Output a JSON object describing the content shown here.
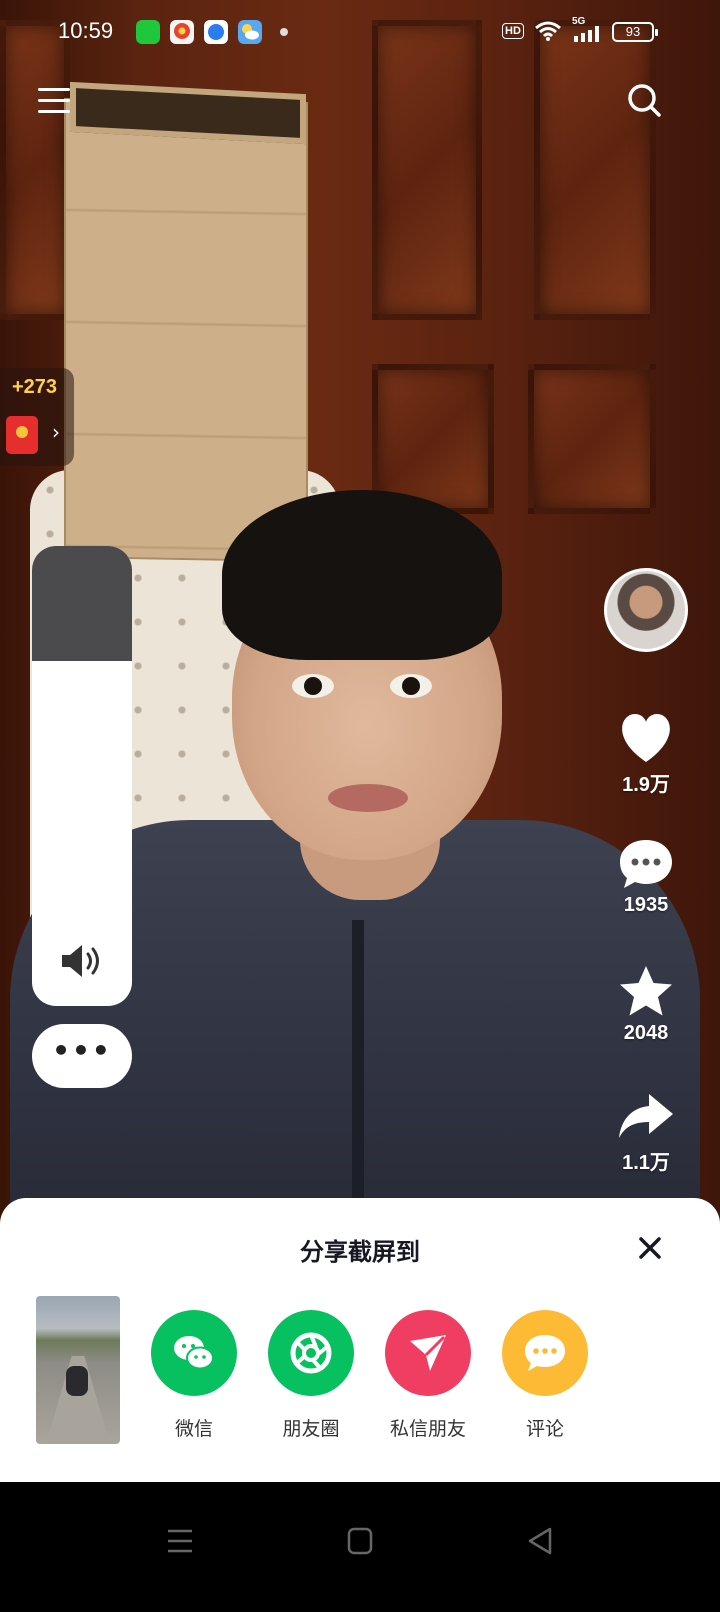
{
  "status_bar": {
    "time": "10:59",
    "network_badge": "HD",
    "signal_label": "5G",
    "battery_level": "93"
  },
  "video": {
    "reward": {
      "points": "+273",
      "chevron": "›"
    },
    "volume": {
      "level": 0.75
    },
    "more_label": "•••",
    "actions": {
      "like_count": "1.9万",
      "comment_count": "1935",
      "favorite_count": "2048",
      "share_count": "1.1万"
    }
  },
  "share_sheet": {
    "title": "分享截屏到",
    "targets": [
      {
        "label": "微信",
        "color": "#07C160",
        "icon": "wechat-icon"
      },
      {
        "label": "朋友圈",
        "color": "#07C160",
        "icon": "moments-icon"
      },
      {
        "label": "私信朋友",
        "color": "#F03E62",
        "icon": "send-icon"
      },
      {
        "label": "评论",
        "color": "#FDBB35",
        "icon": "comment-icon"
      }
    ]
  },
  "colors": {
    "accent_red": "#F03E62",
    "wechat_green": "#07C160",
    "comment_yellow": "#FDBB35",
    "reward_gold": "#FFD24A"
  }
}
